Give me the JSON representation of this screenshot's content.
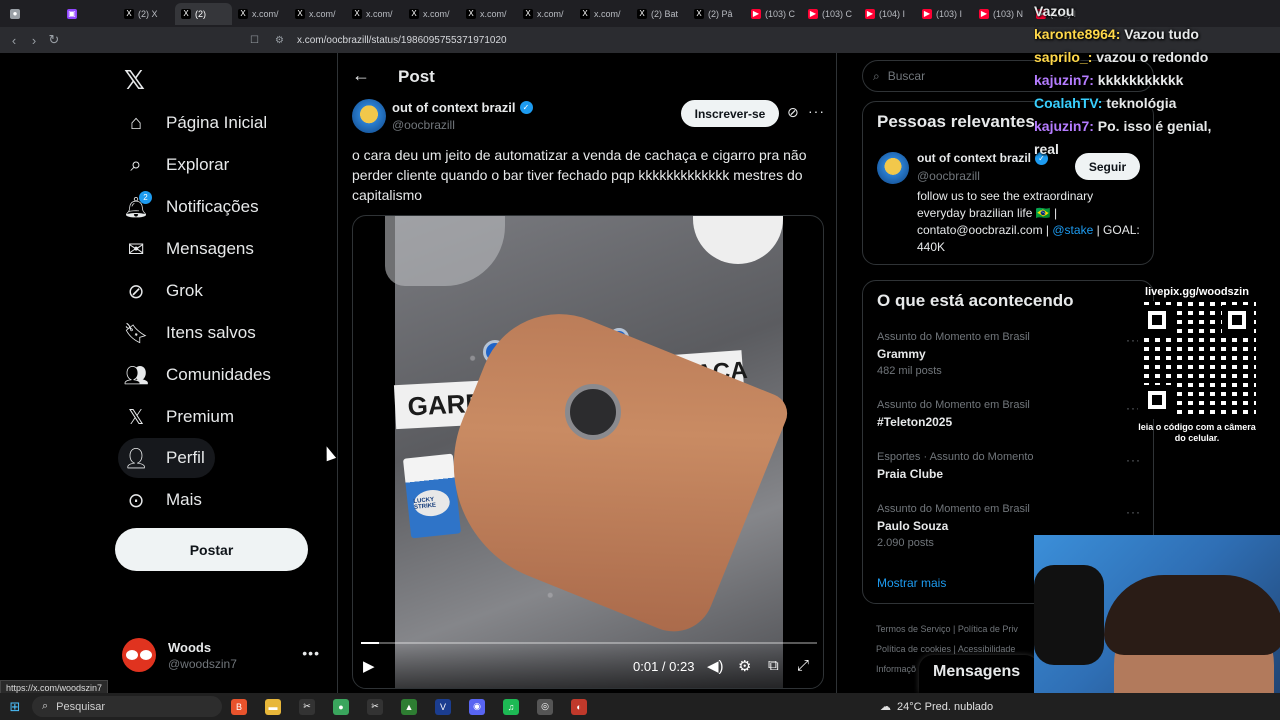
{
  "browser": {
    "tabs": [
      {
        "label": "",
        "icon": "chrome-icon"
      },
      {
        "label": "",
        "icon": "twitch-icon"
      },
      {
        "label": "(2) X",
        "icon": "x-icon"
      },
      {
        "label": "(2)",
        "icon": "x-icon",
        "active": true
      },
      {
        "label": "x.com/",
        "icon": "x-icon"
      },
      {
        "label": "x.com/",
        "icon": "x-icon"
      },
      {
        "label": "x.com/",
        "icon": "x-icon"
      },
      {
        "label": "x.com/",
        "icon": "x-icon"
      },
      {
        "label": "x.com/",
        "icon": "x-icon"
      },
      {
        "label": "x.com/",
        "icon": "x-icon"
      },
      {
        "label": "x.com/",
        "icon": "x-icon"
      },
      {
        "label": "(2) Bat",
        "icon": "x-icon"
      },
      {
        "label": "(2) Pâ",
        "icon": "x-icon"
      },
      {
        "label": "(103) C",
        "icon": "youtube-icon"
      },
      {
        "label": "(103) C",
        "icon": "youtube-icon"
      },
      {
        "label": "(104) I",
        "icon": "youtube-icon"
      },
      {
        "label": "(103) I",
        "icon": "youtube-icon"
      },
      {
        "label": "(103) N",
        "icon": "youtube-icon"
      },
      {
        "label": "(103) I",
        "icon": "youtube-icon"
      }
    ],
    "url": "x.com/oocbrazill/status/1986095755371971020",
    "status_url": "https://x.com/woodszin7"
  },
  "nav": {
    "items": [
      {
        "label": "Página Inicial",
        "icon": "home-icon"
      },
      {
        "label": "Explorar",
        "icon": "search-icon"
      },
      {
        "label": "Notificações",
        "icon": "bell-icon",
        "badge": "2"
      },
      {
        "label": "Mensagens",
        "icon": "mail-icon"
      },
      {
        "label": "Grok",
        "icon": "grok-icon"
      },
      {
        "label": "Itens salvos",
        "icon": "bookmark-icon"
      },
      {
        "label": "Comunidades",
        "icon": "communities-icon"
      },
      {
        "label": "Premium",
        "icon": "x-premium-icon"
      },
      {
        "label": "Perfil",
        "icon": "person-icon"
      },
      {
        "label": "Mais",
        "icon": "more-circle-icon"
      }
    ],
    "post_button": "Postar",
    "account": {
      "name": "Woods",
      "handle": "@woodszin7"
    }
  },
  "post": {
    "header_title": "Post",
    "author_name": "out of context brazil",
    "author_handle": "@oocbrazill",
    "subscribe_label": "Inscrever-se",
    "text": "o cara deu um jeito de automatizar a venda de cachaça e cigarro pra não perder cliente quando o bar tiver fechado pqp kkkkkkkkkkkkk mestres do capitalismo",
    "video": {
      "label_left": "GARRO",
      "label_right": "CACHAÇA",
      "pack_text": "LUCKY STRIKE",
      "timecode": "0:01 / 0:23",
      "progress": 0.04
    }
  },
  "sidebar": {
    "search_placeholder": "Buscar",
    "relevant": {
      "title": "Pessoas relevantes",
      "name": "out of context brazil",
      "handle": "@oocbrazill",
      "follow_label": "Seguir",
      "bio_text": "follow us to see the extraordinary everyday brazilian life 🇧🇷 | contato@oocbrazil.com |",
      "bio_link": "@stake",
      "bio_tail": "| GOAL: 440K"
    },
    "trends": {
      "title": "O que está acontecendo",
      "items": [
        {
          "category": "Assunto do Momento em Brasil",
          "title": "Grammy",
          "count": "482 mil posts"
        },
        {
          "category": "Assunto do Momento em Brasil",
          "title": "#Teleton2025",
          "count": ""
        },
        {
          "category": "Esportes · Assunto do Momento",
          "title": "Praia Clube",
          "count": ""
        },
        {
          "category": "Assunto do Momento em Brasil",
          "title": "Paulo Souza",
          "count": "2.090 posts"
        }
      ],
      "show_more": "Mostrar mais"
    },
    "footer": {
      "links_line1": "Termos de Serviço  |  Política de Priv",
      "links_line2": "Política de cookies  |  Acessibilidade",
      "links_line3": "Informaçõ"
    },
    "messages_drawer": "Mensagens"
  },
  "overlay": {
    "chat": [
      {
        "user": "",
        "msg": "Vazou"
      },
      {
        "user": "karonte8964:",
        "msg": "Vazou tudo"
      },
      {
        "user": "saprilo_:",
        "msg": "vazou o redondo"
      },
      {
        "user": "kajuzin7:",
        "msg": "kkkkkkkkkkk"
      },
      {
        "user": "CoalahTV:",
        "msg": "teknológia"
      },
      {
        "user": "kajuzin7:",
        "msg": "Po. isso é genial,"
      },
      {
        "user": "",
        "msg": "real"
      }
    ],
    "qr_title": "livepix.gg/woodszin",
    "qr_caption": "leia o código com a câmera do celular."
  },
  "taskbar": {
    "search_label": "Pesquisar",
    "weather": "24°C  Pred. nublado"
  }
}
